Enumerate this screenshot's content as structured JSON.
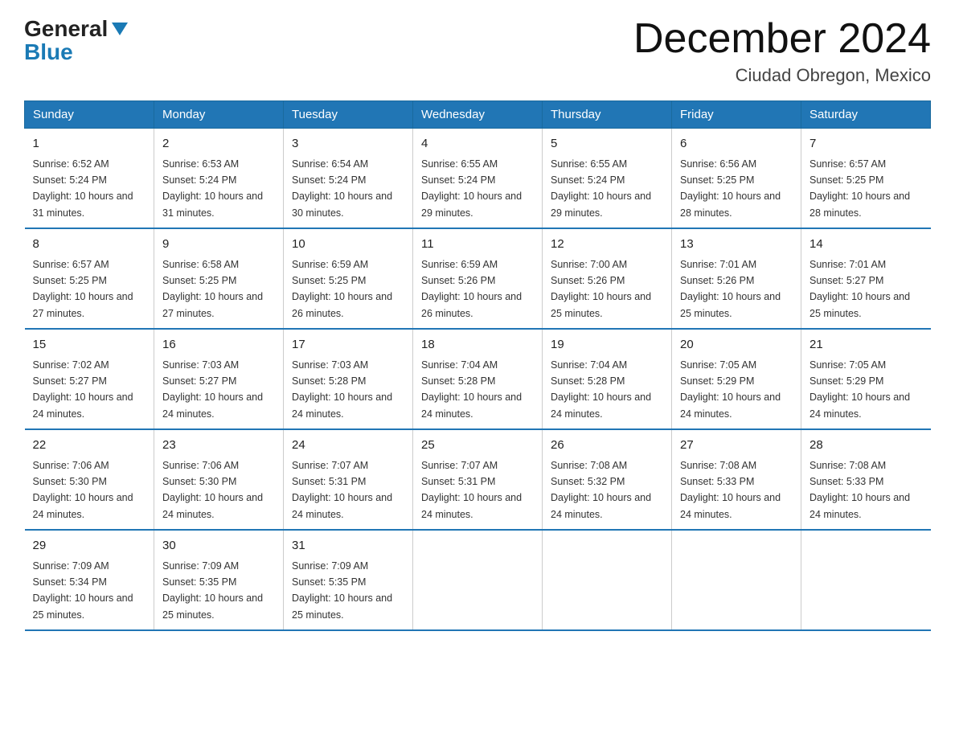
{
  "header": {
    "logo_general": "General",
    "logo_blue": "Blue",
    "title": "December 2024",
    "subtitle": "Ciudad Obregon, Mexico"
  },
  "days_of_week": [
    "Sunday",
    "Monday",
    "Tuesday",
    "Wednesday",
    "Thursday",
    "Friday",
    "Saturday"
  ],
  "weeks": [
    [
      {
        "num": "1",
        "sunrise": "6:52 AM",
        "sunset": "5:24 PM",
        "daylight": "10 hours and 31 minutes."
      },
      {
        "num": "2",
        "sunrise": "6:53 AM",
        "sunset": "5:24 PM",
        "daylight": "10 hours and 31 minutes."
      },
      {
        "num": "3",
        "sunrise": "6:54 AM",
        "sunset": "5:24 PM",
        "daylight": "10 hours and 30 minutes."
      },
      {
        "num": "4",
        "sunrise": "6:55 AM",
        "sunset": "5:24 PM",
        "daylight": "10 hours and 29 minutes."
      },
      {
        "num": "5",
        "sunrise": "6:55 AM",
        "sunset": "5:24 PM",
        "daylight": "10 hours and 29 minutes."
      },
      {
        "num": "6",
        "sunrise": "6:56 AM",
        "sunset": "5:25 PM",
        "daylight": "10 hours and 28 minutes."
      },
      {
        "num": "7",
        "sunrise": "6:57 AM",
        "sunset": "5:25 PM",
        "daylight": "10 hours and 28 minutes."
      }
    ],
    [
      {
        "num": "8",
        "sunrise": "6:57 AM",
        "sunset": "5:25 PM",
        "daylight": "10 hours and 27 minutes."
      },
      {
        "num": "9",
        "sunrise": "6:58 AM",
        "sunset": "5:25 PM",
        "daylight": "10 hours and 27 minutes."
      },
      {
        "num": "10",
        "sunrise": "6:59 AM",
        "sunset": "5:25 PM",
        "daylight": "10 hours and 26 minutes."
      },
      {
        "num": "11",
        "sunrise": "6:59 AM",
        "sunset": "5:26 PM",
        "daylight": "10 hours and 26 minutes."
      },
      {
        "num": "12",
        "sunrise": "7:00 AM",
        "sunset": "5:26 PM",
        "daylight": "10 hours and 25 minutes."
      },
      {
        "num": "13",
        "sunrise": "7:01 AM",
        "sunset": "5:26 PM",
        "daylight": "10 hours and 25 minutes."
      },
      {
        "num": "14",
        "sunrise": "7:01 AM",
        "sunset": "5:27 PM",
        "daylight": "10 hours and 25 minutes."
      }
    ],
    [
      {
        "num": "15",
        "sunrise": "7:02 AM",
        "sunset": "5:27 PM",
        "daylight": "10 hours and 24 minutes."
      },
      {
        "num": "16",
        "sunrise": "7:03 AM",
        "sunset": "5:27 PM",
        "daylight": "10 hours and 24 minutes."
      },
      {
        "num": "17",
        "sunrise": "7:03 AM",
        "sunset": "5:28 PM",
        "daylight": "10 hours and 24 minutes."
      },
      {
        "num": "18",
        "sunrise": "7:04 AM",
        "sunset": "5:28 PM",
        "daylight": "10 hours and 24 minutes."
      },
      {
        "num": "19",
        "sunrise": "7:04 AM",
        "sunset": "5:28 PM",
        "daylight": "10 hours and 24 minutes."
      },
      {
        "num": "20",
        "sunrise": "7:05 AM",
        "sunset": "5:29 PM",
        "daylight": "10 hours and 24 minutes."
      },
      {
        "num": "21",
        "sunrise": "7:05 AM",
        "sunset": "5:29 PM",
        "daylight": "10 hours and 24 minutes."
      }
    ],
    [
      {
        "num": "22",
        "sunrise": "7:06 AM",
        "sunset": "5:30 PM",
        "daylight": "10 hours and 24 minutes."
      },
      {
        "num": "23",
        "sunrise": "7:06 AM",
        "sunset": "5:30 PM",
        "daylight": "10 hours and 24 minutes."
      },
      {
        "num": "24",
        "sunrise": "7:07 AM",
        "sunset": "5:31 PM",
        "daylight": "10 hours and 24 minutes."
      },
      {
        "num": "25",
        "sunrise": "7:07 AM",
        "sunset": "5:31 PM",
        "daylight": "10 hours and 24 minutes."
      },
      {
        "num": "26",
        "sunrise": "7:08 AM",
        "sunset": "5:32 PM",
        "daylight": "10 hours and 24 minutes."
      },
      {
        "num": "27",
        "sunrise": "7:08 AM",
        "sunset": "5:33 PM",
        "daylight": "10 hours and 24 minutes."
      },
      {
        "num": "28",
        "sunrise": "7:08 AM",
        "sunset": "5:33 PM",
        "daylight": "10 hours and 24 minutes."
      }
    ],
    [
      {
        "num": "29",
        "sunrise": "7:09 AM",
        "sunset": "5:34 PM",
        "daylight": "10 hours and 25 minutes."
      },
      {
        "num": "30",
        "sunrise": "7:09 AM",
        "sunset": "5:35 PM",
        "daylight": "10 hours and 25 minutes."
      },
      {
        "num": "31",
        "sunrise": "7:09 AM",
        "sunset": "5:35 PM",
        "daylight": "10 hours and 25 minutes."
      },
      null,
      null,
      null,
      null
    ]
  ]
}
